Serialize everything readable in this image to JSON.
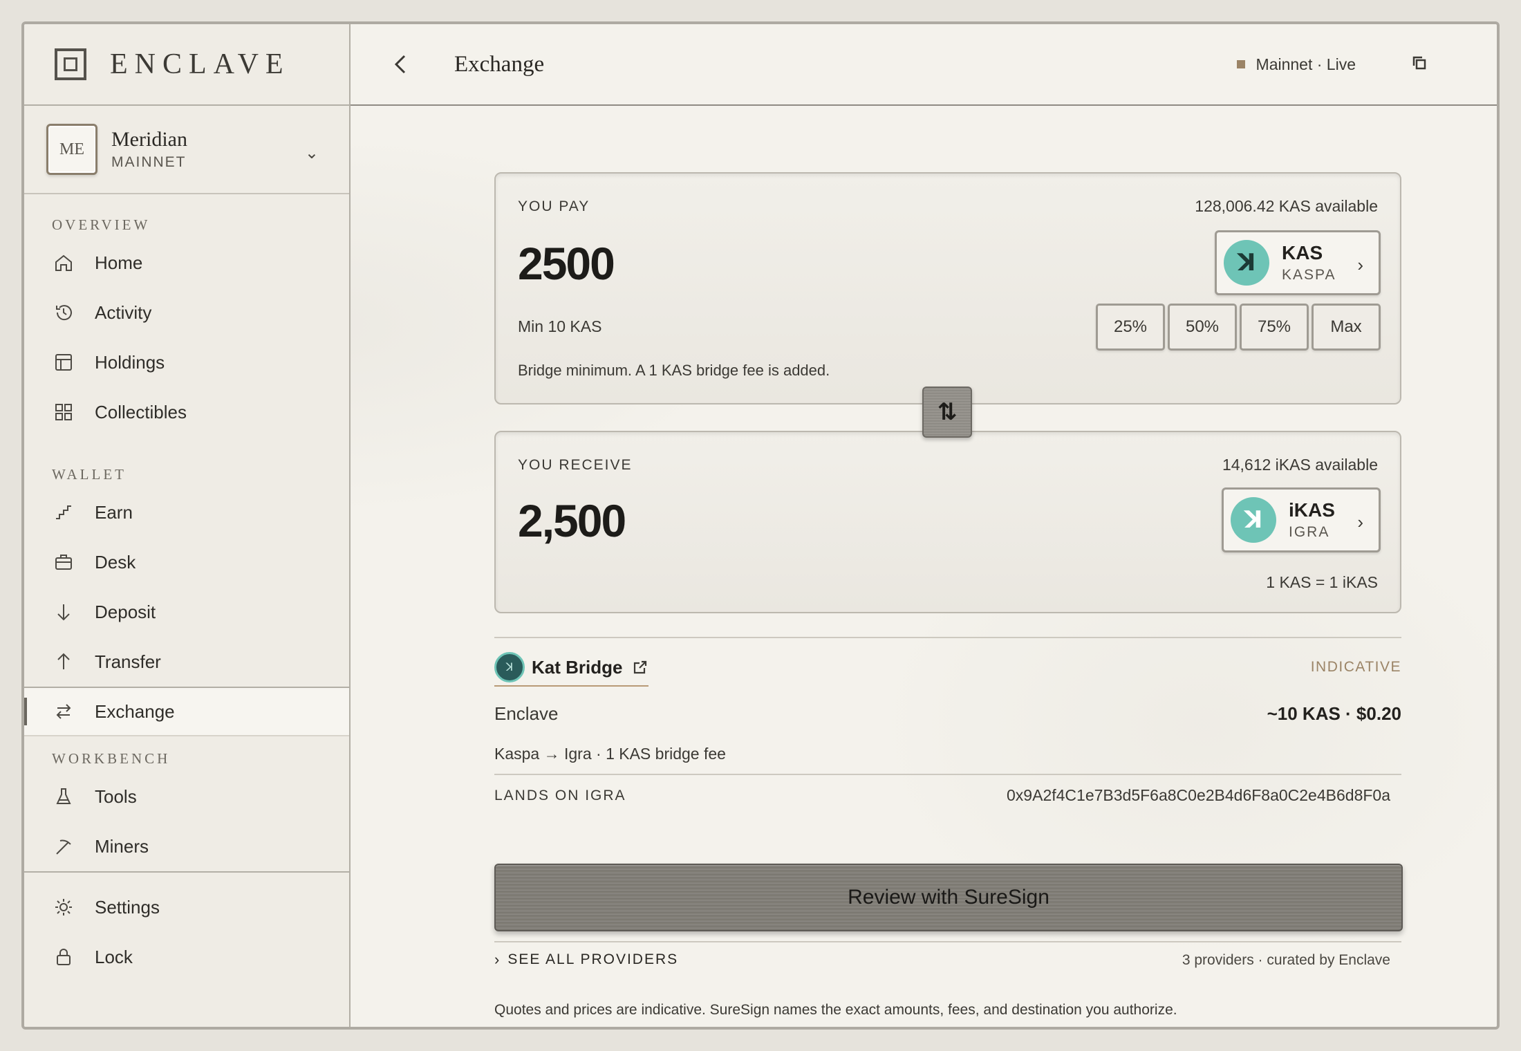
{
  "brand": {
    "name": "ENCLAVE"
  },
  "account": {
    "initials": "ME",
    "name": "Meridian",
    "network": "MAINNET"
  },
  "sidebar": {
    "sections": {
      "overview": "OVERVIEW",
      "wallet": "WALLET",
      "workbench": "WORKBENCH"
    },
    "items": {
      "home": "Home",
      "activity": "Activity",
      "holdings": "Holdings",
      "collectibles": "Collectibles",
      "earn": "Earn",
      "desk": "Desk",
      "deposit": "Deposit",
      "transfer": "Transfer",
      "exchange": "Exchange",
      "tools": "Tools",
      "miners": "Miners",
      "settings": "Settings",
      "lock": "Lock"
    },
    "active": "exchange"
  },
  "header": {
    "title": "Exchange",
    "network_status": "Mainnet · Live"
  },
  "pay": {
    "label": "YOU PAY",
    "available": "128,006.42 KAS available",
    "amount": "2500",
    "token_symbol": "KAS",
    "token_chain": "KASPA",
    "min_text": "Min 10 KAS",
    "percent_buttons": [
      "25%",
      "50%",
      "75%",
      "Max"
    ],
    "note": "Bridge minimum. A 1 KAS bridge fee is added."
  },
  "receive": {
    "label": "YOU RECEIVE",
    "available": "14,612 iKAS available",
    "amount": "2,500",
    "token_symbol": "iKAS",
    "token_chain": "IGRA",
    "rate": "1 KAS = 1 iKAS"
  },
  "provider": {
    "name": "Kat Bridge",
    "badge": "INDICATIVE",
    "source": "Enclave",
    "price": "~10 KAS · $0.20",
    "route": "Kaspa → Igra · 1 KAS bridge fee",
    "lands_label": "LANDS ON IGRA",
    "lands_address": "0x9A2f4C1e7B3d5F6a8C0e2B4d6F8a0C2e4B6d8F0a"
  },
  "actions": {
    "review": "Review with SureSign",
    "see_all": "SEE ALL PROVIDERS",
    "providers_meta": "3 providers · curated by Enclave"
  },
  "disclaimer": "Quotes and prices are indicative. SureSign names the exact amounts, fees, and destination you authorize.",
  "colors": {
    "accent": "#9b8466",
    "token_teal": "#6ec4b6",
    "background": "#f4f2ec"
  }
}
